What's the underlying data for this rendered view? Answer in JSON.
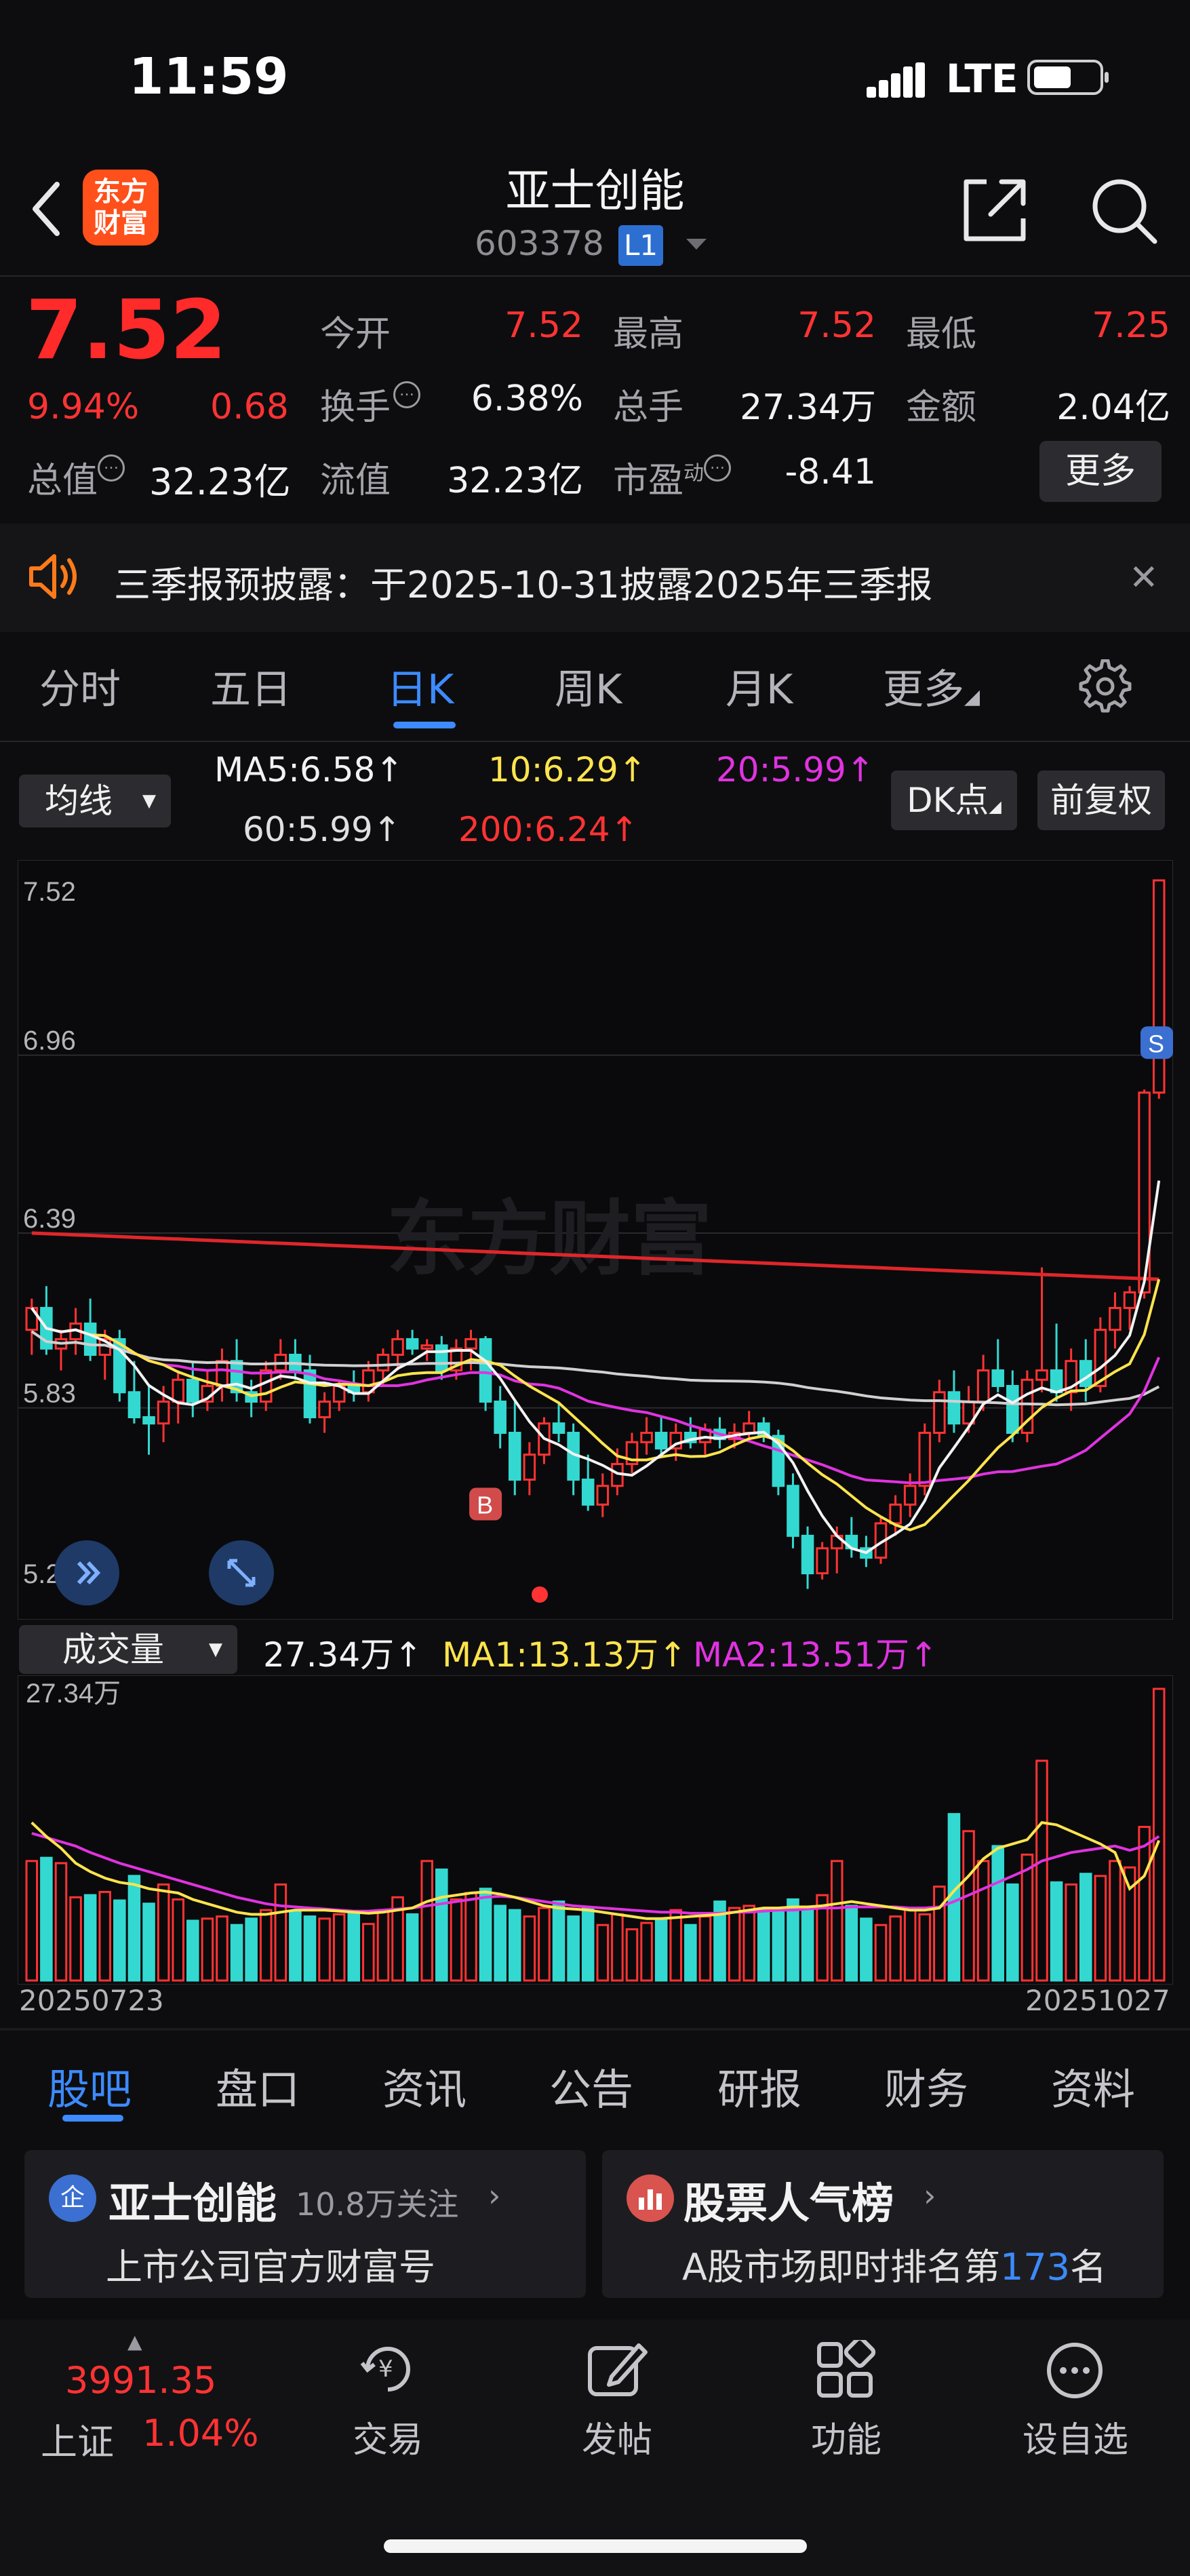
{
  "status_bar": {
    "time": "11:59",
    "network": "LTE"
  },
  "header": {
    "logo_line1": "东方",
    "logo_line2": "财富",
    "stock_name": "亚士创能",
    "stock_code": "603378",
    "level_badge": "L1"
  },
  "quote": {
    "price": "7.52",
    "change_pct": "9.94%",
    "change": "0.68",
    "rows": [
      [
        {
          "label": "今开",
          "value": "7.52",
          "color": "#ff3333"
        },
        {
          "label": "最高",
          "value": "7.52",
          "color": "#ff3333"
        },
        {
          "label": "最低",
          "value": "7.25",
          "color": "#ff3333"
        }
      ],
      [
        {
          "label": "换手",
          "value": "6.38%",
          "color": "#f0f0f0"
        },
        {
          "label": "总手",
          "value": "27.34万",
          "color": "#f0f0f0"
        },
        {
          "label": "金额",
          "value": "2.04亿",
          "color": "#f0f0f0"
        }
      ],
      [
        {
          "label": "流值",
          "value": "32.23亿",
          "color": "#f0f0f0"
        },
        {
          "label": "市盈",
          "value": "-8.41",
          "color": "#f0f0f0"
        }
      ]
    ],
    "pe_superscript": "动",
    "total_cap_label": "总值",
    "total_cap_value": "32.23亿",
    "more_button": "更多"
  },
  "notice": {
    "text": "三季报预披露：于2025-10-31披露2025年三季报"
  },
  "chart_tabs": [
    "分时",
    "五日",
    "日K",
    "周K",
    "月K",
    "更多"
  ],
  "ma_bar": {
    "selector": "均线",
    "ma5": "MA5:6.58↑",
    "ma10": "10:6.29↑",
    "ma20": "20:5.99↑",
    "ma60": "60:5.99↑",
    "ma200": "200:6.24↑",
    "dk_button": "DK点",
    "adjust_button": "前复权"
  },
  "colors": {
    "up": "#ff3333",
    "down": "#33d9d1",
    "ma5": "#f2f2f2",
    "ma10": "#ffe44d",
    "ma20": "#e033e0",
    "ma60": "#d0d0d0",
    "ma200": "#e0262b",
    "accent": "#3d8bff"
  },
  "chart_data": {
    "type": "candlestick",
    "y_ticks": [
      "7.52",
      "6.96",
      "6.39",
      "5.83",
      "5.26"
    ],
    "ylim": [
      5.26,
      7.52
    ],
    "markers": [
      "B",
      "S"
    ],
    "candles": [
      [
        6.08,
        6.18,
        6.0,
        6.15
      ],
      [
        6.15,
        6.22,
        6.0,
        6.02
      ],
      [
        6.02,
        6.08,
        5.95,
        6.05
      ],
      [
        6.05,
        6.15,
        6.0,
        6.1
      ],
      [
        6.1,
        6.18,
        5.98,
        6.0
      ],
      [
        6.0,
        6.08,
        5.92,
        6.05
      ],
      [
        6.05,
        6.08,
        5.85,
        5.88
      ],
      [
        5.88,
        5.98,
        5.78,
        5.8
      ],
      [
        5.8,
        5.9,
        5.68,
        5.78
      ],
      [
        5.78,
        5.9,
        5.72,
        5.85
      ],
      [
        5.85,
        5.95,
        5.78,
        5.92
      ],
      [
        5.92,
        5.98,
        5.8,
        5.85
      ],
      [
        5.85,
        5.95,
        5.82,
        5.9
      ],
      [
        5.9,
        6.02,
        5.85,
        5.98
      ],
      [
        5.98,
        6.05,
        5.85,
        5.88
      ],
      [
        5.88,
        5.92,
        5.8,
        5.85
      ],
      [
        5.85,
        5.98,
        5.82,
        5.95
      ],
      [
        5.95,
        6.05,
        5.92,
        6.0
      ],
      [
        6.0,
        6.05,
        5.92,
        5.95
      ],
      [
        5.95,
        6.0,
        5.78,
        5.8
      ],
      [
        5.8,
        5.88,
        5.75,
        5.85
      ],
      [
        5.85,
        5.92,
        5.82,
        5.9
      ],
      [
        5.9,
        5.95,
        5.85,
        5.88
      ],
      [
        5.88,
        5.98,
        5.85,
        5.95
      ],
      [
        5.95,
        6.02,
        5.9,
        6.0
      ],
      [
        6.0,
        6.08,
        5.95,
        6.05
      ],
      [
        6.05,
        6.08,
        6.0,
        6.02
      ],
      [
        6.02,
        6.05,
        5.98,
        6.03
      ],
      [
        6.03,
        6.06,
        5.92,
        5.95
      ],
      [
        5.95,
        6.05,
        5.92,
        6.02
      ],
      [
        6.02,
        6.08,
        5.95,
        6.05
      ],
      [
        6.05,
        6.06,
        5.82,
        5.85
      ],
      [
        5.85,
        5.9,
        5.7,
        5.75
      ],
      [
        5.75,
        5.85,
        5.55,
        5.6
      ],
      [
        5.6,
        5.72,
        5.55,
        5.68
      ],
      [
        5.68,
        5.8,
        5.65,
        5.78
      ],
      [
        5.78,
        5.85,
        5.72,
        5.75
      ],
      [
        5.75,
        5.78,
        5.55,
        5.6
      ],
      [
        5.6,
        5.68,
        5.5,
        5.52
      ],
      [
        5.52,
        5.62,
        5.48,
        5.58
      ],
      [
        5.58,
        5.7,
        5.55,
        5.65
      ],
      [
        5.65,
        5.75,
        5.62,
        5.72
      ],
      [
        5.72,
        5.8,
        5.68,
        5.75
      ],
      [
        5.75,
        5.8,
        5.68,
        5.7
      ],
      [
        5.7,
        5.78,
        5.66,
        5.75
      ],
      [
        5.75,
        5.8,
        5.7,
        5.72
      ],
      [
        5.72,
        5.78,
        5.68,
        5.76
      ],
      [
        5.76,
        5.8,
        5.7,
        5.73
      ],
      [
        5.73,
        5.78,
        5.7,
        5.75
      ],
      [
        5.75,
        5.82,
        5.72,
        5.78
      ],
      [
        5.78,
        5.8,
        5.72,
        5.74
      ],
      [
        5.74,
        5.76,
        5.55,
        5.58
      ],
      [
        5.58,
        5.62,
        5.38,
        5.42
      ],
      [
        5.42,
        5.45,
        5.25,
        5.3
      ],
      [
        5.3,
        5.4,
        5.28,
        5.38
      ],
      [
        5.38,
        5.45,
        5.3,
        5.42
      ],
      [
        5.42,
        5.48,
        5.35,
        5.38
      ],
      [
        5.38,
        5.42,
        5.32,
        5.35
      ],
      [
        5.35,
        5.48,
        5.33,
        5.46
      ],
      [
        5.46,
        5.55,
        5.42,
        5.52
      ],
      [
        5.52,
        5.62,
        5.48,
        5.58
      ],
      [
        5.58,
        5.78,
        5.55,
        5.75
      ],
      [
        5.75,
        5.92,
        5.72,
        5.88
      ],
      [
        5.88,
        5.95,
        5.75,
        5.78
      ],
      [
        5.78,
        5.9,
        5.75,
        5.85
      ],
      [
        5.85,
        6.0,
        5.82,
        5.95
      ],
      [
        5.95,
        6.05,
        5.88,
        5.9
      ],
      [
        5.9,
        5.95,
        5.72,
        5.75
      ],
      [
        5.75,
        5.95,
        5.72,
        5.92
      ],
      [
        5.92,
        6.28,
        5.88,
        5.95
      ],
      [
        5.95,
        6.1,
        5.85,
        5.88
      ],
      [
        5.88,
        6.02,
        5.82,
        5.98
      ],
      [
        5.98,
        6.05,
        5.85,
        5.9
      ],
      [
        5.9,
        6.12,
        5.88,
        6.08
      ],
      [
        6.08,
        6.2,
        6.02,
        6.15
      ],
      [
        6.15,
        6.22,
        6.08,
        6.2
      ],
      [
        6.2,
        6.85,
        6.18,
        6.84
      ],
      [
        6.84,
        7.52,
        6.82,
        7.52
      ]
    ],
    "volume": {
      "y_tick": "27.34万",
      "first_date": "20250723",
      "last_date": "20251027",
      "selector": "成交量",
      "current": "27.34万↑",
      "ma1": "MA1:13.13万↑",
      "ma2": "MA2:13.51万↑",
      "values": [
        11.2,
        11.5,
        11.0,
        7.8,
        8.0,
        8.3,
        7.5,
        9.8,
        7.2,
        9.0,
        7.6,
        5.6,
        5.8,
        6.0,
        5.2,
        5.8,
        6.6,
        9.0,
        6.4,
        6.0,
        5.8,
        6.2,
        6.4,
        5.3,
        6.6,
        7.8,
        6.2,
        11.2,
        10.4,
        7.6,
        8.2,
        8.6,
        7.0,
        6.6,
        6.0,
        6.8,
        7.4,
        6.0,
        6.8,
        5.2,
        6.2,
        4.8,
        5.4,
        5.8,
        6.6,
        5.2,
        6.0,
        7.4,
        6.8,
        7.0,
        6.6,
        6.4,
        7.6,
        6.8,
        8.0,
        11.2,
        7.0,
        5.8,
        5.2,
        6.0,
        6.8,
        6.2,
        8.8,
        15.6,
        14.0,
        11.2,
        12.6,
        9.0,
        11.8,
        20.6,
        9.2,
        9.0,
        10.0,
        9.8,
        11.2,
        10.6,
        14.4,
        27.34
      ],
      "ma1_values": [
        14.8,
        13.5,
        12.4,
        11.0,
        10.2,
        9.6,
        9.2,
        9.0,
        8.6,
        8.4,
        8.2,
        7.6,
        7.2,
        6.8,
        6.4,
        6.2,
        6.2,
        6.4,
        6.6,
        6.6,
        6.6,
        6.5,
        6.4,
        6.3,
        6.4,
        6.6,
        6.8,
        7.4,
        7.8,
        8.0,
        8.2,
        8.3,
        8.1,
        7.8,
        7.4,
        7.0,
        6.8,
        6.7,
        6.6,
        6.4,
        6.2,
        6.0,
        5.8,
        5.8,
        5.9,
        6.0,
        6.1,
        6.2,
        6.4,
        6.6,
        6.8,
        6.8,
        6.9,
        6.9,
        7.0,
        7.2,
        7.4,
        7.2,
        7.0,
        6.8,
        6.6,
        6.6,
        6.8,
        8.4,
        9.8,
        11.4,
        12.4,
        12.8,
        13.2,
        14.8,
        14.6,
        14.0,
        13.4,
        12.8,
        12.0,
        8.6,
        9.8,
        13.13
      ],
      "ma2_values": [
        13.8,
        13.4,
        13.0,
        12.6,
        12.0,
        11.5,
        11.0,
        10.6,
        10.2,
        9.8,
        9.4,
        9.0,
        8.6,
        8.2,
        7.8,
        7.5,
        7.2,
        7.0,
        6.9,
        6.8,
        6.7,
        6.6,
        6.5,
        6.5,
        6.6,
        6.7,
        6.8,
        7.0,
        7.2,
        7.4,
        7.6,
        7.8,
        7.9,
        7.8,
        7.6,
        7.4,
        7.2,
        7.0,
        6.9,
        6.8,
        6.7,
        6.6,
        6.5,
        6.4,
        6.4,
        6.3,
        6.3,
        6.3,
        6.4,
        6.4,
        6.5,
        6.6,
        6.6,
        6.7,
        6.8,
        6.8,
        6.9,
        6.9,
        6.9,
        6.9,
        6.8,
        6.8,
        6.9,
        7.4,
        8.0,
        8.6,
        9.2,
        9.8,
        10.4,
        11.2,
        11.6,
        12.0,
        12.2,
        12.4,
        12.6,
        12.2,
        12.6,
        13.51
      ]
    }
  },
  "bottom_tabs": [
    "股吧",
    "盘口",
    "资讯",
    "公告",
    "研报",
    "财务",
    "资料"
  ],
  "cards": {
    "left": {
      "title": "亚士创能",
      "follow": "10.8万关注",
      "subtitle": "上市公司官方财富号",
      "badge": "企"
    },
    "right": {
      "title": "股票人气榜",
      "subtitle_prefix": "A股市场即时排名第",
      "rank": "173",
      "subtitle_suffix": "名"
    }
  },
  "bottom_nav": {
    "index_value": "3991.35",
    "index_name": "上证",
    "index_pct": "1.04%",
    "items": [
      "交易",
      "发帖",
      "功能",
      "设自选"
    ]
  }
}
